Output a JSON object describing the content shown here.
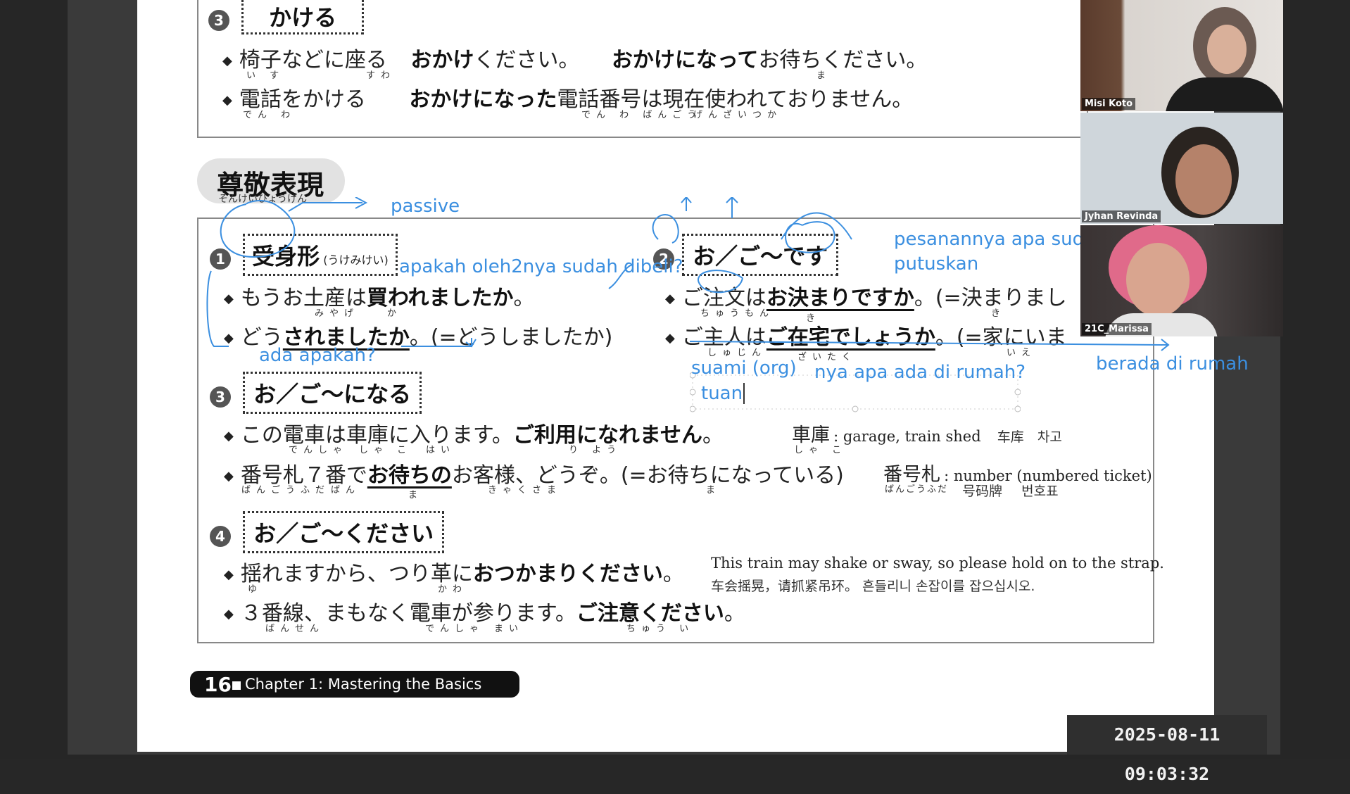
{
  "section_kakeru": {
    "number": "3",
    "heading": "かける",
    "line1": {
      "a": "椅子などに座る",
      "b": "おかけ",
      "c": "ください。",
      "d": "おかけになって",
      "e": "お待ちください。"
    },
    "line1_furi": {
      "a": "い す",
      "b": "すわ",
      "c": "ま"
    },
    "line2": {
      "a": "電話をかける",
      "b": "おかけになった",
      "c": "電話番号は現在使われておりません。"
    },
    "line2_furi": {
      "a": "でん わ",
      "b": "でん わ ばんごう",
      "c": "げんざいつか"
    }
  },
  "title": {
    "kanji": "尊敬表現",
    "furigana": "そんけいひょうげん"
  },
  "s1": {
    "number": "1",
    "heading": "受身形",
    "heading_sub": "(うけみけい)",
    "line1": {
      "a": "もうお土産は",
      "b": "買われましたか",
      "c": "。"
    },
    "line1_furi": {
      "a": "みやげ",
      "b": "か"
    },
    "line2": {
      "a": "どう",
      "b": "されましたか",
      "c": "。(=どうしましたか)"
    }
  },
  "s2": {
    "number": "2",
    "heading": "お／ご〜です",
    "line1": {
      "a": "ご注文は",
      "b": "お決まりですか",
      "c": "。(=決まりまし"
    },
    "line1_furi": {
      "a": "ちゅうもん",
      "b": "き",
      "c": "き"
    },
    "line2": {
      "a": "ご主人は",
      "b": "ご在宅でしょうか",
      "c": "。(=家にいま"
    },
    "line2_furi": {
      "a": "しゅじん",
      "b": "ざいたく",
      "c": "いえ"
    }
  },
  "s3": {
    "number": "3",
    "heading": "お／ご〜になる",
    "line1": {
      "a": "この電車は車庫に入ります。",
      "b": "ご利用になれません",
      "c": "。"
    },
    "line1_furi": {
      "a": "でんしゃ",
      "b": "しゃ こ",
      "c": "はい",
      "d": "り よう"
    },
    "note1": {
      "word": "車庫",
      "furi": "しゃ こ",
      "en": ": garage, train shed",
      "zh": "车库",
      "ko": "차고"
    },
    "line2": {
      "a": "番号札７番で",
      "b": "お待ちの",
      "c": "お客様、どうぞ。(=お待ちになっている)"
    },
    "line2_furi": {
      "a": "ばんごうふだ",
      "b": "ばん",
      "c": "ま",
      "d": "きゃくさま",
      "e": "ま"
    },
    "note2": {
      "word": "番号札",
      "furi": "ばんごうふだ",
      "en": ": number (numbered ticket)",
      "zh": "号码牌",
      "ko": "번호표"
    }
  },
  "s4": {
    "number": "4",
    "heading": "お／ご〜ください",
    "line1": {
      "a": "揺れますから、つり革に",
      "b": "おつかまりください",
      "c": "。"
    },
    "line1_furi": {
      "a": "ゆ",
      "b": "かわ"
    },
    "note1_en": "This train may shake or sway, so please hold on to the strap.",
    "note1_cn": "车会摇晃，请抓紧吊环。 흔들리니 손잡이를 잡으십시오.",
    "line2": {
      "a": "３番線、まもなく電車が参ります。",
      "b": "ご注意ください",
      "c": "。"
    },
    "line2_furi": {
      "a": "ばんせん",
      "b": "でんしゃ",
      "c": "まい",
      "d": "ちゅう い"
    }
  },
  "annotations": {
    "passive": "passive",
    "apakah": "apakah oleh2nya sudah dibeli?",
    "ada_apakah": "ada apakah?",
    "pesanan": "pesanannya apa sud",
    "putuskan": "putuskan",
    "suami": "suami (org)",
    "nya_apa": "nya apa ada di rumah?",
    "tuan": "tuan",
    "berada": "berada di rumah"
  },
  "footer": {
    "page_number": "16",
    "chapter": "Chapter 1: Mastering the Basics"
  },
  "timestamp": "2025-08-11  09:03:32",
  "participants": [
    {
      "name": "Misi Koto"
    },
    {
      "name": "Jyhan Revinda"
    },
    {
      "name": "21C_Marissa"
    }
  ],
  "colors": {
    "annotation_blue": "#3b8fe0",
    "page_bg": "#ffffff",
    "backdrop": "#262626"
  }
}
